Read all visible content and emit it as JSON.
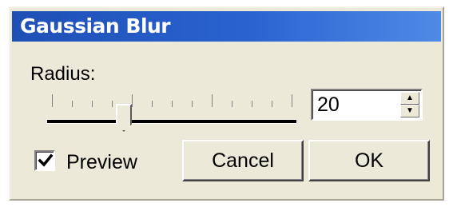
{
  "window": {
    "title": "Gaussian Blur"
  },
  "radius": {
    "label": "Radius:",
    "value": "20",
    "slider_fraction": 0.3,
    "spin_up_icon": "triangle-up",
    "spin_down_icon": "triangle-down"
  },
  "preview": {
    "label": "Preview",
    "checked": true
  },
  "buttons": {
    "cancel_label": "Cancel",
    "ok_label": "OK"
  },
  "colors": {
    "titlebar": "#2a63d0",
    "dialog_bg": "#ece9d8"
  }
}
